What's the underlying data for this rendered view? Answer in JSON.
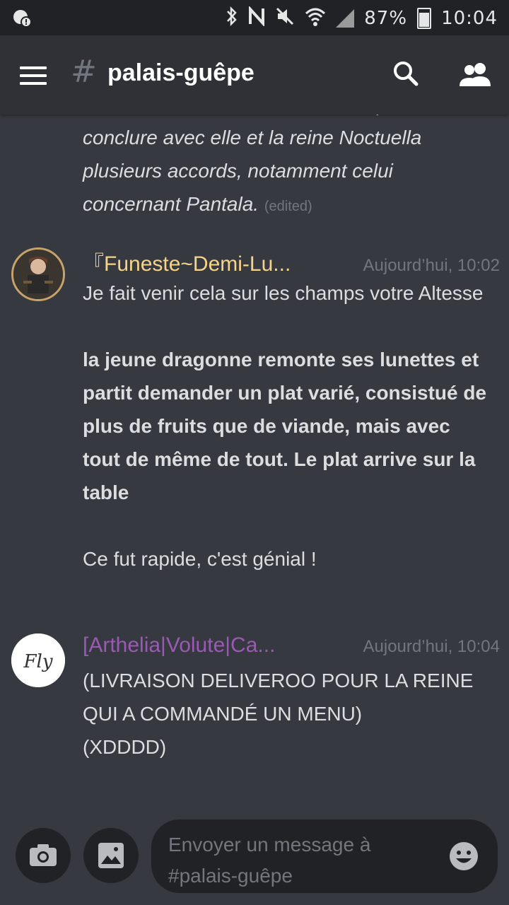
{
  "status_bar": {
    "battery": "87%",
    "time": "10:04"
  },
  "header": {
    "channel_name": "palais-guêpe",
    "hash_symbol": "#"
  },
  "messages": {
    "previous": {
      "lines": [
        "conversation, son oeil est vif. J'espère",
        "conclure avec elle et la reine Noctuella",
        "plusieurs accords, notamment celui",
        "concernant Pantala."
      ],
      "edited": "(edited)"
    },
    "items": [
      {
        "author": "『Funeste~Demi-Lu...",
        "author_color": "#f5d48a",
        "timestamp": "Aujourd’hui, 10:02",
        "paragraph1": "Je fait venir cela sur les champs votre Altesse",
        "paragraph2": "la jeune dragonne remonte ses lunettes et partit demander un plat varié, consistué de plus de fruits que de viande, mais avec tout de même de tout. Le plat arrive sur la table",
        "paragraph3": "Ce fut rapide, c'est génial !"
      },
      {
        "author": "[Arthelia|Volute|Ca...",
        "author_color": "#9b59b6",
        "timestamp": "Aujourd’hui, 10:04",
        "paragraph1": "(LIVRAISON DELIVEROO POUR LA REINE QUI A COMMANDÉ UN MENU)",
        "paragraph2": "(XDDDD)",
        "avatar_text": "Fly"
      }
    ]
  },
  "composer": {
    "placeholder": "Envoyer un message à #palais-guêpe"
  }
}
